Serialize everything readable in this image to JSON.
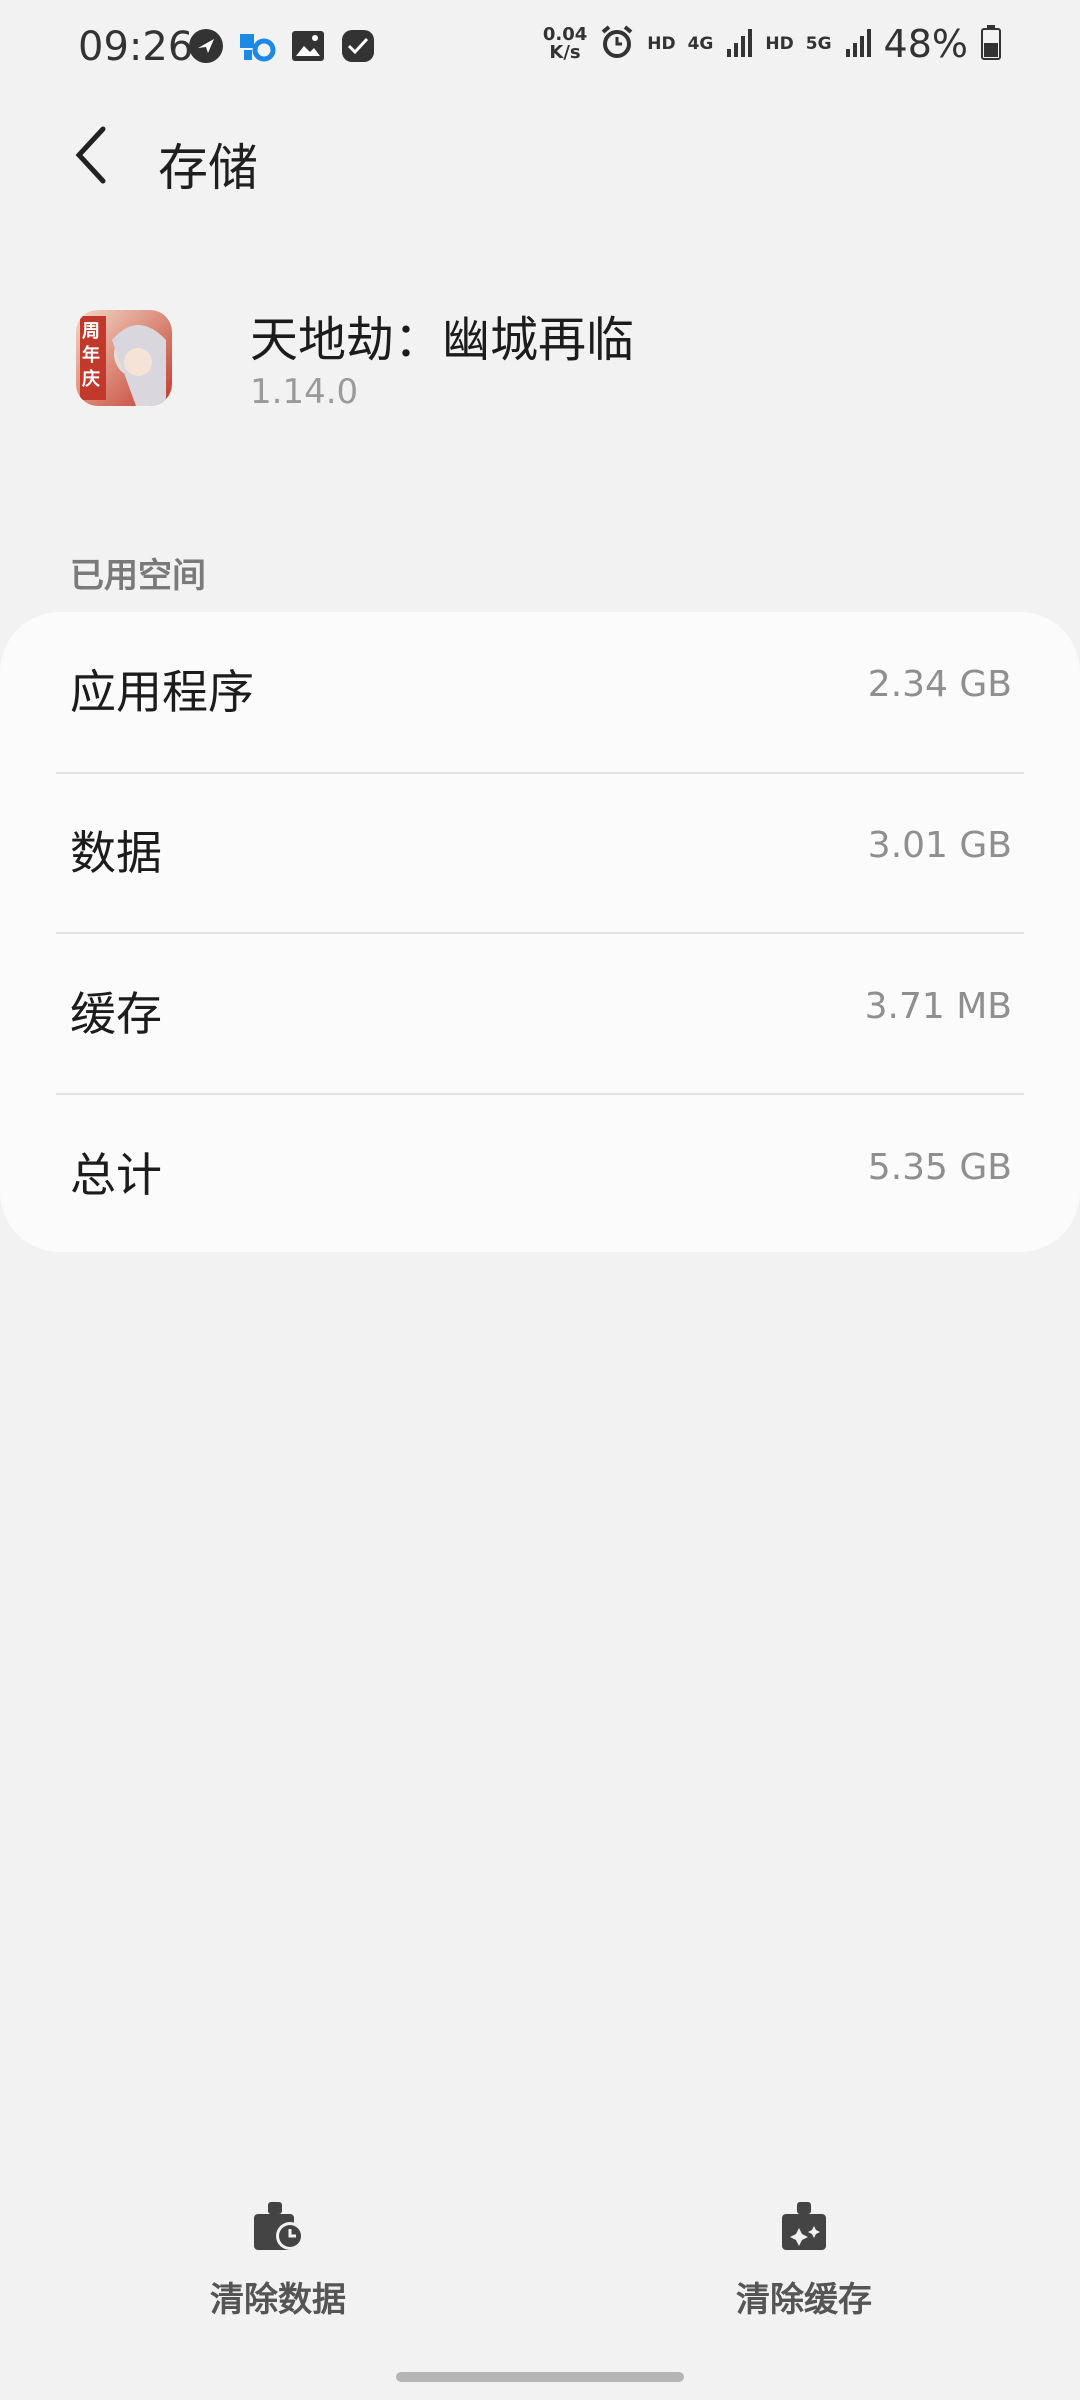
{
  "status_bar": {
    "time": "09:26",
    "net_speed_value": "0.04",
    "net_speed_unit": "K/s",
    "hd1": "HD",
    "net1": "4G",
    "hd2": "HD",
    "net2": "5G",
    "battery": "48%",
    "left_icons": [
      "bird-notification-icon",
      "puzzle-gear-icon",
      "image-icon",
      "check-icon"
    ]
  },
  "header": {
    "title": "存储"
  },
  "app": {
    "name": "天地劫：幽城再临",
    "version": "1.14.0",
    "icon_badge": "周年庆"
  },
  "section": {
    "label": "已用空间"
  },
  "storage_rows": [
    {
      "label": "应用程序",
      "value": "2.34 GB"
    },
    {
      "label": "数据",
      "value": "3.01 GB"
    },
    {
      "label": "缓存",
      "value": "3.71 MB"
    },
    {
      "label": "总计",
      "value": "5.35 GB"
    }
  ],
  "actions": {
    "clear_data": "清除数据",
    "clear_cache": "清除缓存"
  },
  "colors": {
    "background": "#f2f2f2",
    "card": "#fbfbfb",
    "accent_blue": "#1e88e5"
  }
}
